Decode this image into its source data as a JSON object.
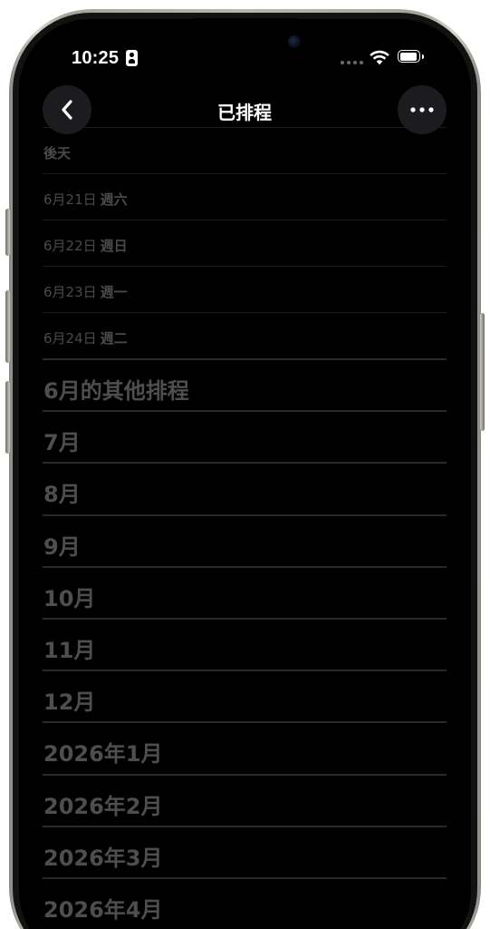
{
  "status_bar": {
    "time": "10:25"
  },
  "nav": {
    "title": "已排程",
    "back_icon": "chevron-left-icon",
    "more_icon": "ellipsis-icon"
  },
  "days": [
    {
      "date": "後天",
      "weekday": ""
    },
    {
      "date": "6月21日",
      "weekday": "週六"
    },
    {
      "date": "6月22日",
      "weekday": "週日"
    },
    {
      "date": "6月23日",
      "weekday": "週一"
    },
    {
      "date": "6月24日",
      "weekday": "週二"
    }
  ],
  "sections": [
    "6月的其他排程",
    "7月",
    "8月",
    "9月",
    "10月",
    "11月",
    "12月",
    "2026年1月",
    "2026年2月",
    "2026年3月",
    "2026年4月"
  ],
  "colors": {
    "background": "#000000",
    "nav_button_bg": "#1c1c1e",
    "primary_text": "#ffffff",
    "dim_text": "#4a4a4c"
  }
}
